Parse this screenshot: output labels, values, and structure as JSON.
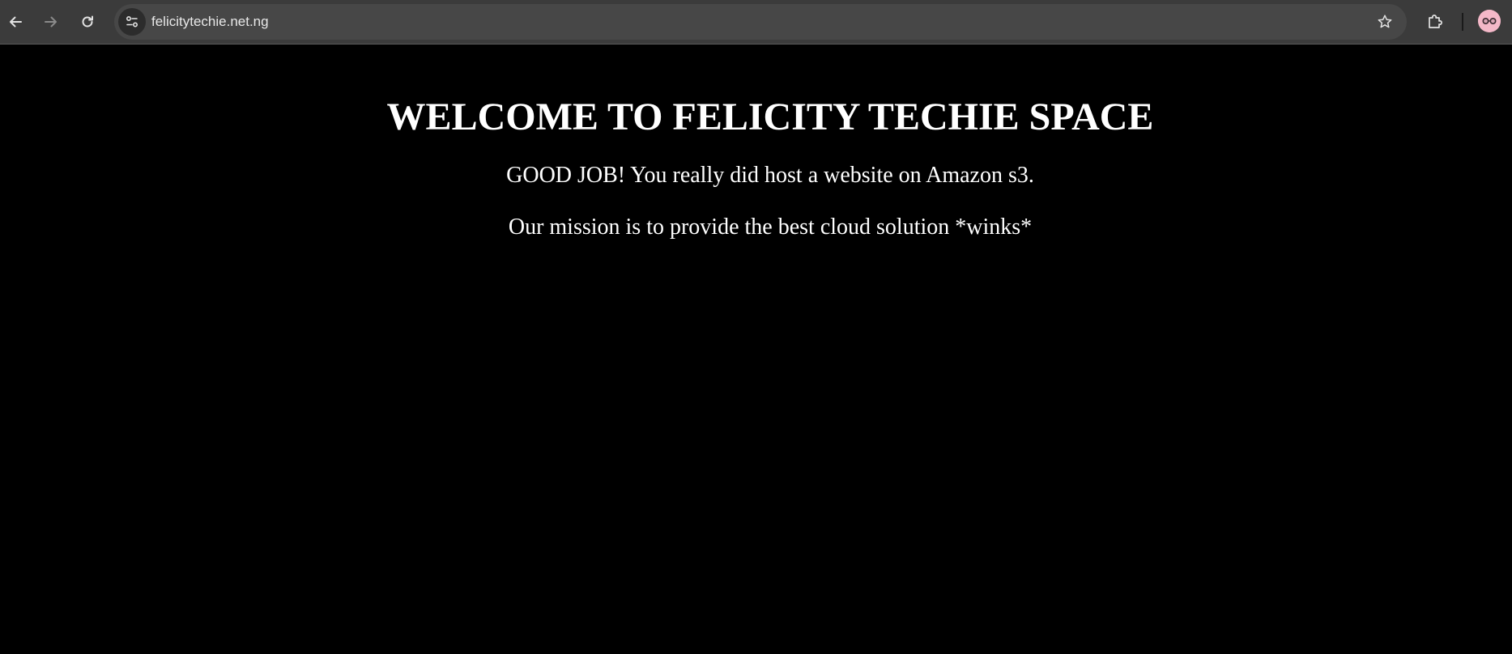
{
  "browser": {
    "url": "felicitytechie.net.ng",
    "icons": {
      "back": "arrow-left-icon",
      "forward": "arrow-right-icon",
      "reload": "reload-icon",
      "site_info": "tune-icon",
      "bookmark": "star-icon",
      "extensions": "puzzle-icon",
      "profile": "avatar-glasses-icon"
    },
    "colors": {
      "toolbar": "#3b3b3b",
      "omnibox": "#474747",
      "avatar": "#f4b8c8"
    }
  },
  "page": {
    "heading": "WELCOME TO FELICITY TECHIE SPACE",
    "paragraph1": "GOOD JOB! You really did host a website on Amazon s3.",
    "paragraph2": "Our mission is to provide the best cloud solution *winks*",
    "colors": {
      "background": "#000000",
      "text": "#ffffff"
    }
  }
}
